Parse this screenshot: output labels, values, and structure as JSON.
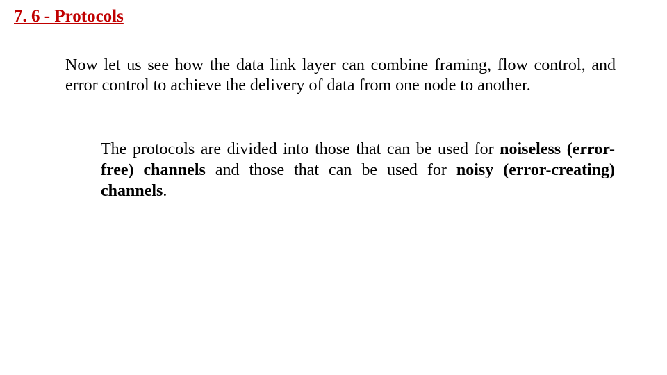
{
  "heading": "7. 6 - Protocols",
  "p1": "Now let us see how the data link layer can combine framing, flow control, and error control to achieve the delivery of data from one node to another.",
  "p2": {
    "t1": "The protocols are divided into those that can be used for ",
    "b1": "noiseless (error-free) channels",
    "t2": " and those that can be used for ",
    "b2": "noisy (error-creating) channels",
    "t3": "."
  }
}
